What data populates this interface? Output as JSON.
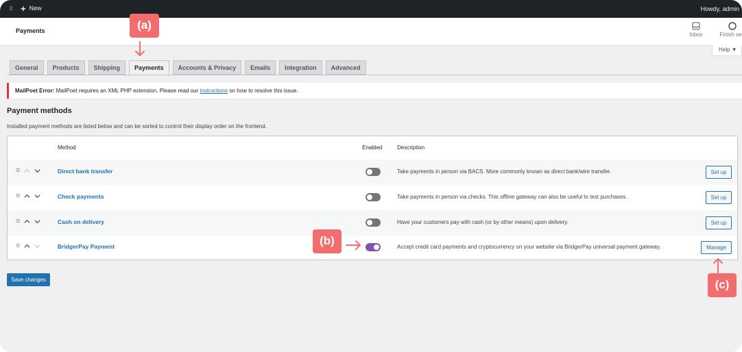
{
  "adminbar": {
    "wp_label": "0",
    "new_label": "New",
    "howdy": "Howdy, admin"
  },
  "header": {
    "title": "Payments",
    "inbox_label": "Inbox",
    "finish_label": "Finish setup",
    "help_label": "Help ▼"
  },
  "tabs": [
    {
      "label": "General"
    },
    {
      "label": "Products"
    },
    {
      "label": "Shipping"
    },
    {
      "label": "Payments",
      "active": true
    },
    {
      "label": "Accounts & Privacy"
    },
    {
      "label": "Emails"
    },
    {
      "label": "Integration"
    },
    {
      "label": "Advanced"
    }
  ],
  "notice": {
    "prefix": "MailPoet Error:",
    "text": "MailPoet requires an XML PHP extension. Please read our",
    "link": "instructions",
    "suffix": "on how to resolve this issue."
  },
  "section": {
    "title": "Payment methods",
    "description": "Installed payment methods are listed below and can be sorted to control their display order on the frontend."
  },
  "table": {
    "columns": {
      "method": "Method",
      "enabled": "Enabled",
      "description": "Description"
    },
    "rows": [
      {
        "name": "Direct bank transfer",
        "enabled": false,
        "description": "Take payments in person via BACS. More commonly known as direct bank/wire transfer.",
        "action": "Set up"
      },
      {
        "name": "Check payments",
        "enabled": false,
        "description": "Take payments in person via checks. This offline gateway can also be useful to test purchases.",
        "action": "Set up"
      },
      {
        "name": "Cash on delivery",
        "enabled": false,
        "description": "Have your customers pay with cash (or by other means) upon delivery.",
        "action": "Set up"
      },
      {
        "name": "BridgerPay Payment",
        "enabled": true,
        "description": "Accept credit card payments and cryptocurrency on your website via BridgerPay universal payment gateway.",
        "action": "Manage"
      }
    ]
  },
  "save_label": "Save changes",
  "annotations": {
    "a": "(a)",
    "b": "(b)",
    "c": "(c)"
  },
  "colors": {
    "accent": "#2271b1",
    "toggle_on": "#7f54b3",
    "annotation": "#f26d6d",
    "error": "#d63638"
  }
}
